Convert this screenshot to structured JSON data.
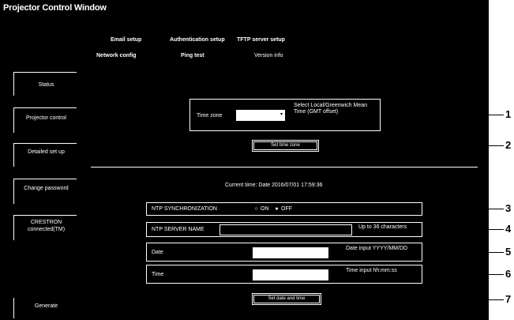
{
  "window": {
    "title": "Projector Control Window"
  },
  "top_menu": {
    "row1": [
      "Email setup",
      "Authentication setup",
      "TFTP server setup"
    ],
    "row2": [
      "Network config",
      "Ping test",
      "Version info"
    ]
  },
  "sidebar": {
    "items": [
      {
        "label": "Status"
      },
      {
        "label": "Projector control"
      },
      {
        "label": "Detailed set up"
      },
      {
        "label": "Change password"
      },
      {
        "label": "CRESTRON connected(TM)"
      },
      {
        "label": "Generate"
      }
    ]
  },
  "timezone": {
    "label": "Time zone",
    "value": "",
    "note": "Select Local/Greenwich Mean Time (GMT offset)"
  },
  "set_timezone_button": "Set time zone",
  "current_time": "Current time: Date 2016/07/01 17:59:36",
  "ntp": {
    "sync_label": "NTP SYNCHRONIZATION",
    "on": "ON",
    "off": "OFF",
    "server_label": "NTP SERVER NAME",
    "server_note": "Up to 36 characters"
  },
  "date": {
    "label": "Date",
    "value": "",
    "note": "Date input YYYY/MM/DD"
  },
  "time": {
    "label": "Time",
    "value": "",
    "note": "Time input hh:mm:ss"
  },
  "set_date_time_button": "Set date and time",
  "callouts": [
    "1",
    "2",
    "3",
    "4",
    "5",
    "6",
    "7"
  ]
}
